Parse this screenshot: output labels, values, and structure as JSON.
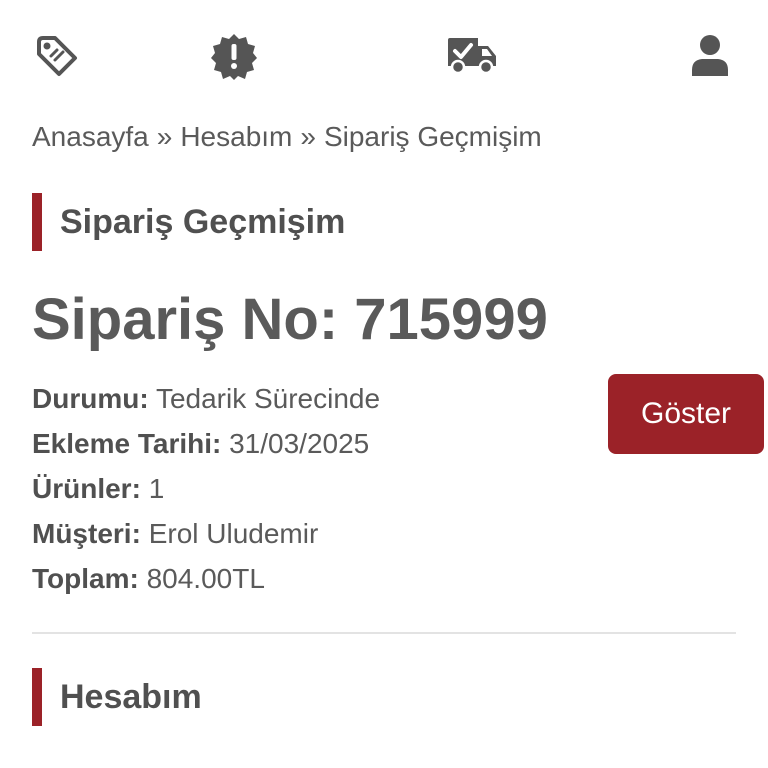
{
  "topbar": {
    "icons": [
      {
        "name": "tag-icon"
      },
      {
        "name": "alert-badge-icon"
      },
      {
        "name": "delivery-truck-icon"
      },
      {
        "name": "user-icon"
      }
    ]
  },
  "breadcrumb": {
    "items": [
      "Anasayfa",
      "Hesabım",
      "Sipariş Geçmişim"
    ],
    "separator": "»"
  },
  "orders_section": {
    "title": "Sipariş Geçmişim"
  },
  "order": {
    "number_label": "Sipariş No: 715999",
    "status_label": "Durumu:",
    "status_value": "Tedarik Sürecinde",
    "date_label": "Ekleme Tarihi:",
    "date_value": "31/03/2025",
    "products_label": "Ürünler:",
    "products_value": "1",
    "customer_label": "Müşteri:",
    "customer_value": "Erol Uludemir",
    "total_label": "Toplam:",
    "total_value": "804.00TL",
    "show_button": "Göster"
  },
  "account_section": {
    "title": "Hesabım"
  },
  "colors": {
    "accent": "#9b2228",
    "text": "#5a5a5a",
    "divider": "#e3e3e3"
  }
}
